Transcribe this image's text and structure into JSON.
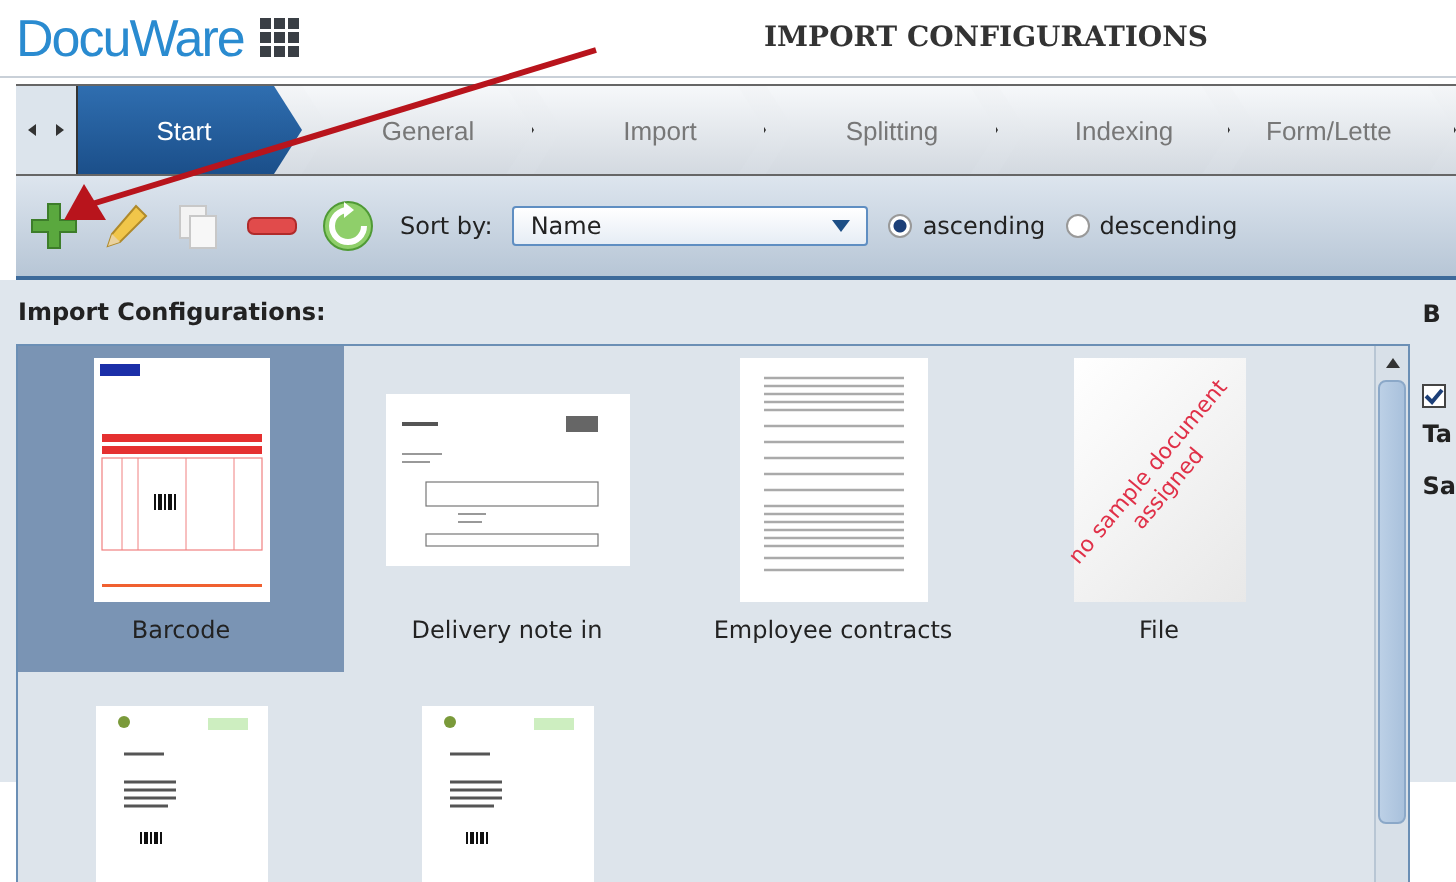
{
  "header": {
    "logo": "DocuWare",
    "title": "IMPORT CONFIGURATIONS"
  },
  "tabs": [
    {
      "label": "Start",
      "selected": true
    },
    {
      "label": "General",
      "selected": false
    },
    {
      "label": "Import",
      "selected": false
    },
    {
      "label": "Splitting",
      "selected": false
    },
    {
      "label": "Indexing",
      "selected": false
    },
    {
      "label": "Form/Lette",
      "selected": false
    }
  ],
  "toolbar": {
    "sort_label": "Sort by:",
    "sort_value": "Name",
    "order": [
      {
        "label": "ascending",
        "selected": true
      },
      {
        "label": "descending",
        "selected": false
      }
    ]
  },
  "section_title": "Import Configurations:",
  "configurations": [
    {
      "kind": "invoice",
      "label": "Barcode",
      "selected": true
    },
    {
      "kind": "delivery",
      "label": "Delivery note in",
      "selected": false
    },
    {
      "kind": "contract",
      "label": "Employee contracts",
      "selected": false
    },
    {
      "kind": "none",
      "label": "File",
      "selected": false,
      "stamp": "no sample document assigned"
    },
    {
      "kind": "letter",
      "selected": false
    },
    {
      "kind": "letter",
      "selected": false
    }
  ],
  "side_panel": {
    "heading": "B",
    "checkbox": {
      "checked": true
    },
    "lines": [
      "Ta",
      "Sa"
    ]
  }
}
